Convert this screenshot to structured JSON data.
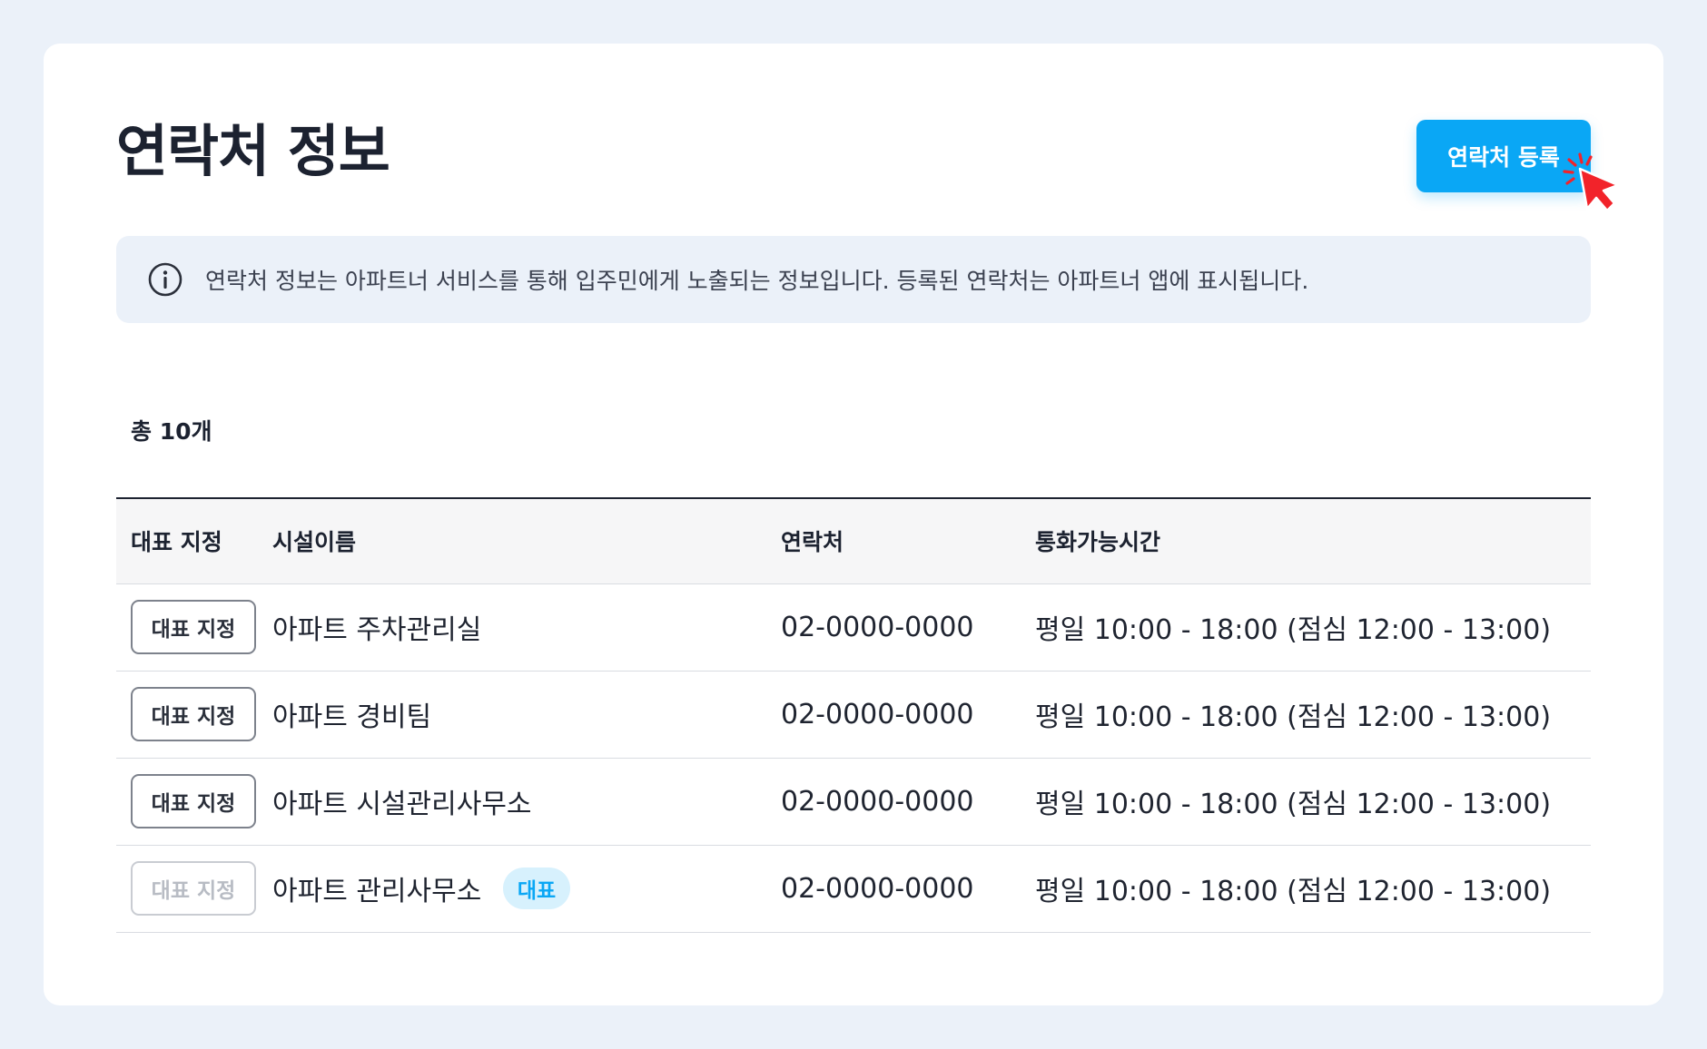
{
  "page": {
    "title": "연락처 정보",
    "register_label": "연락처 등록"
  },
  "info": {
    "text": "연락처 정보는 아파트너 서비스를 통해 입주민에게 노출되는 정보입니다. 등록된 연락처는 아파트너 앱에 표시됩니다."
  },
  "summary": {
    "total": "총 10개"
  },
  "table": {
    "headers": [
      "대표 지정",
      "시설이름",
      "연락처",
      "통화가능시간"
    ],
    "rows": [
      {
        "action": "대표 지정",
        "name": "아파트 주차관리실",
        "phone": "02-0000-0000",
        "hours": "평일 10:00 - 18:00 (점심 12:00 - 13:00)",
        "badge": ""
      },
      {
        "action": "대표 지정",
        "name": "아파트 경비팀",
        "phone": "02-0000-0000",
        "hours": "평일 10:00 - 18:00 (점심 12:00 - 13:00)",
        "badge": ""
      },
      {
        "action": "대표 지정",
        "name": "아파트 시설관리사무소",
        "phone": "02-0000-0000",
        "hours": "평일 10:00 - 18:00 (점심 12:00 - 13:00)",
        "badge": ""
      },
      {
        "action": "대표 지정",
        "name": "아파트 관리사무소",
        "phone": "02-0000-0000",
        "hours": "평일 10:00 - 18:00 (점심 12:00 - 13:00)",
        "badge": "대표"
      }
    ]
  },
  "icons": {
    "info": "info-circle-icon",
    "cursor": "pointer-cursor-icon"
  },
  "colors": {
    "accent": "#0aa7f5",
    "badge_bg": "#d7f1fd",
    "cursor": "#f2232a",
    "page_bg": "#ebf1f9"
  }
}
